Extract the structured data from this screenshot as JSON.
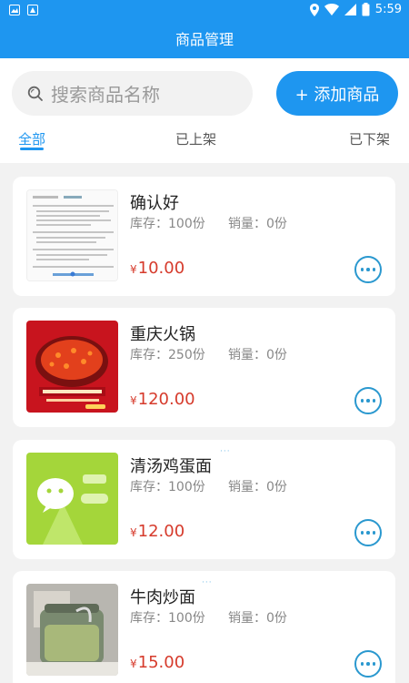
{
  "status_bar": {
    "time": "5:59"
  },
  "app_bar": {
    "title": "商品管理"
  },
  "search": {
    "placeholder": "搜索商品名称"
  },
  "add_button": {
    "label": "+ 添加商品"
  },
  "tabs": [
    {
      "label": "全部",
      "active": true
    },
    {
      "label": "已上架",
      "active": false
    },
    {
      "label": "已下架",
      "active": false
    }
  ],
  "products": [
    {
      "name": "确认好",
      "stock": "库存：100份",
      "sold": "销量：0份",
      "currency": "¥",
      "price": "10.00"
    },
    {
      "name": "重庆火锅",
      "stock": "库存：250份",
      "sold": "销量：0份",
      "currency": "¥",
      "price": "120.00"
    },
    {
      "name": "清汤鸡蛋面",
      "stock": "库存：100份",
      "sold": "销量：0份",
      "currency": "¥",
      "price": "12.00"
    },
    {
      "name": "牛肉炒面",
      "stock": "库存：100份",
      "sold": "销量：0份",
      "currency": "¥",
      "price": "15.00"
    }
  ],
  "colors": {
    "primary": "#1e96f0",
    "price": "#d63b2c",
    "background": "#f2f2f2"
  }
}
